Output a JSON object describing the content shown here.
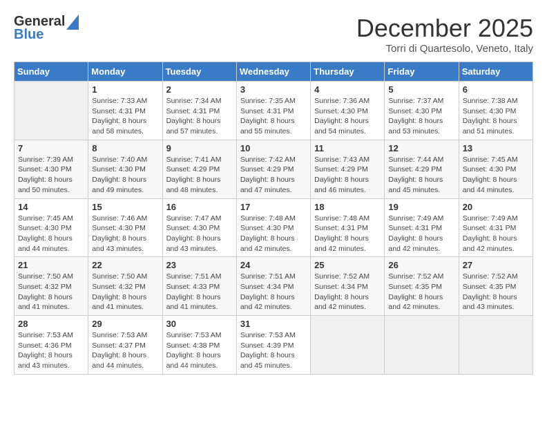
{
  "header": {
    "logo_line1": "General",
    "logo_line2": "Blue",
    "month": "December 2025",
    "location": "Torri di Quartesolo, Veneto, Italy"
  },
  "days_of_week": [
    "Sunday",
    "Monday",
    "Tuesday",
    "Wednesday",
    "Thursday",
    "Friday",
    "Saturday"
  ],
  "weeks": [
    [
      {
        "day": "",
        "info": ""
      },
      {
        "day": "1",
        "info": "Sunrise: 7:33 AM\nSunset: 4:31 PM\nDaylight: 8 hours\nand 58 minutes."
      },
      {
        "day": "2",
        "info": "Sunrise: 7:34 AM\nSunset: 4:31 PM\nDaylight: 8 hours\nand 57 minutes."
      },
      {
        "day": "3",
        "info": "Sunrise: 7:35 AM\nSunset: 4:31 PM\nDaylight: 8 hours\nand 55 minutes."
      },
      {
        "day": "4",
        "info": "Sunrise: 7:36 AM\nSunset: 4:30 PM\nDaylight: 8 hours\nand 54 minutes."
      },
      {
        "day": "5",
        "info": "Sunrise: 7:37 AM\nSunset: 4:30 PM\nDaylight: 8 hours\nand 53 minutes."
      },
      {
        "day": "6",
        "info": "Sunrise: 7:38 AM\nSunset: 4:30 PM\nDaylight: 8 hours\nand 51 minutes."
      }
    ],
    [
      {
        "day": "7",
        "info": "Sunrise: 7:39 AM\nSunset: 4:30 PM\nDaylight: 8 hours\nand 50 minutes."
      },
      {
        "day": "8",
        "info": "Sunrise: 7:40 AM\nSunset: 4:30 PM\nDaylight: 8 hours\nand 49 minutes."
      },
      {
        "day": "9",
        "info": "Sunrise: 7:41 AM\nSunset: 4:29 PM\nDaylight: 8 hours\nand 48 minutes."
      },
      {
        "day": "10",
        "info": "Sunrise: 7:42 AM\nSunset: 4:29 PM\nDaylight: 8 hours\nand 47 minutes."
      },
      {
        "day": "11",
        "info": "Sunrise: 7:43 AM\nSunset: 4:29 PM\nDaylight: 8 hours\nand 46 minutes."
      },
      {
        "day": "12",
        "info": "Sunrise: 7:44 AM\nSunset: 4:29 PM\nDaylight: 8 hours\nand 45 minutes."
      },
      {
        "day": "13",
        "info": "Sunrise: 7:45 AM\nSunset: 4:30 PM\nDaylight: 8 hours\nand 44 minutes."
      }
    ],
    [
      {
        "day": "14",
        "info": "Sunrise: 7:45 AM\nSunset: 4:30 PM\nDaylight: 8 hours\nand 44 minutes."
      },
      {
        "day": "15",
        "info": "Sunrise: 7:46 AM\nSunset: 4:30 PM\nDaylight: 8 hours\nand 43 minutes."
      },
      {
        "day": "16",
        "info": "Sunrise: 7:47 AM\nSunset: 4:30 PM\nDaylight: 8 hours\nand 43 minutes."
      },
      {
        "day": "17",
        "info": "Sunrise: 7:48 AM\nSunset: 4:30 PM\nDaylight: 8 hours\nand 42 minutes."
      },
      {
        "day": "18",
        "info": "Sunrise: 7:48 AM\nSunset: 4:31 PM\nDaylight: 8 hours\nand 42 minutes."
      },
      {
        "day": "19",
        "info": "Sunrise: 7:49 AM\nSunset: 4:31 PM\nDaylight: 8 hours\nand 42 minutes."
      },
      {
        "day": "20",
        "info": "Sunrise: 7:49 AM\nSunset: 4:31 PM\nDaylight: 8 hours\nand 42 minutes."
      }
    ],
    [
      {
        "day": "21",
        "info": "Sunrise: 7:50 AM\nSunset: 4:32 PM\nDaylight: 8 hours\nand 41 minutes."
      },
      {
        "day": "22",
        "info": "Sunrise: 7:50 AM\nSunset: 4:32 PM\nDaylight: 8 hours\nand 41 minutes."
      },
      {
        "day": "23",
        "info": "Sunrise: 7:51 AM\nSunset: 4:33 PM\nDaylight: 8 hours\nand 41 minutes."
      },
      {
        "day": "24",
        "info": "Sunrise: 7:51 AM\nSunset: 4:34 PM\nDaylight: 8 hours\nand 42 minutes."
      },
      {
        "day": "25",
        "info": "Sunrise: 7:52 AM\nSunset: 4:34 PM\nDaylight: 8 hours\nand 42 minutes."
      },
      {
        "day": "26",
        "info": "Sunrise: 7:52 AM\nSunset: 4:35 PM\nDaylight: 8 hours\nand 42 minutes."
      },
      {
        "day": "27",
        "info": "Sunrise: 7:52 AM\nSunset: 4:35 PM\nDaylight: 8 hours\nand 43 minutes."
      }
    ],
    [
      {
        "day": "28",
        "info": "Sunrise: 7:53 AM\nSunset: 4:36 PM\nDaylight: 8 hours\nand 43 minutes."
      },
      {
        "day": "29",
        "info": "Sunrise: 7:53 AM\nSunset: 4:37 PM\nDaylight: 8 hours\nand 44 minutes."
      },
      {
        "day": "30",
        "info": "Sunrise: 7:53 AM\nSunset: 4:38 PM\nDaylight: 8 hours\nand 44 minutes."
      },
      {
        "day": "31",
        "info": "Sunrise: 7:53 AM\nSunset: 4:39 PM\nDaylight: 8 hours\nand 45 minutes."
      },
      {
        "day": "",
        "info": ""
      },
      {
        "day": "",
        "info": ""
      },
      {
        "day": "",
        "info": ""
      }
    ]
  ]
}
